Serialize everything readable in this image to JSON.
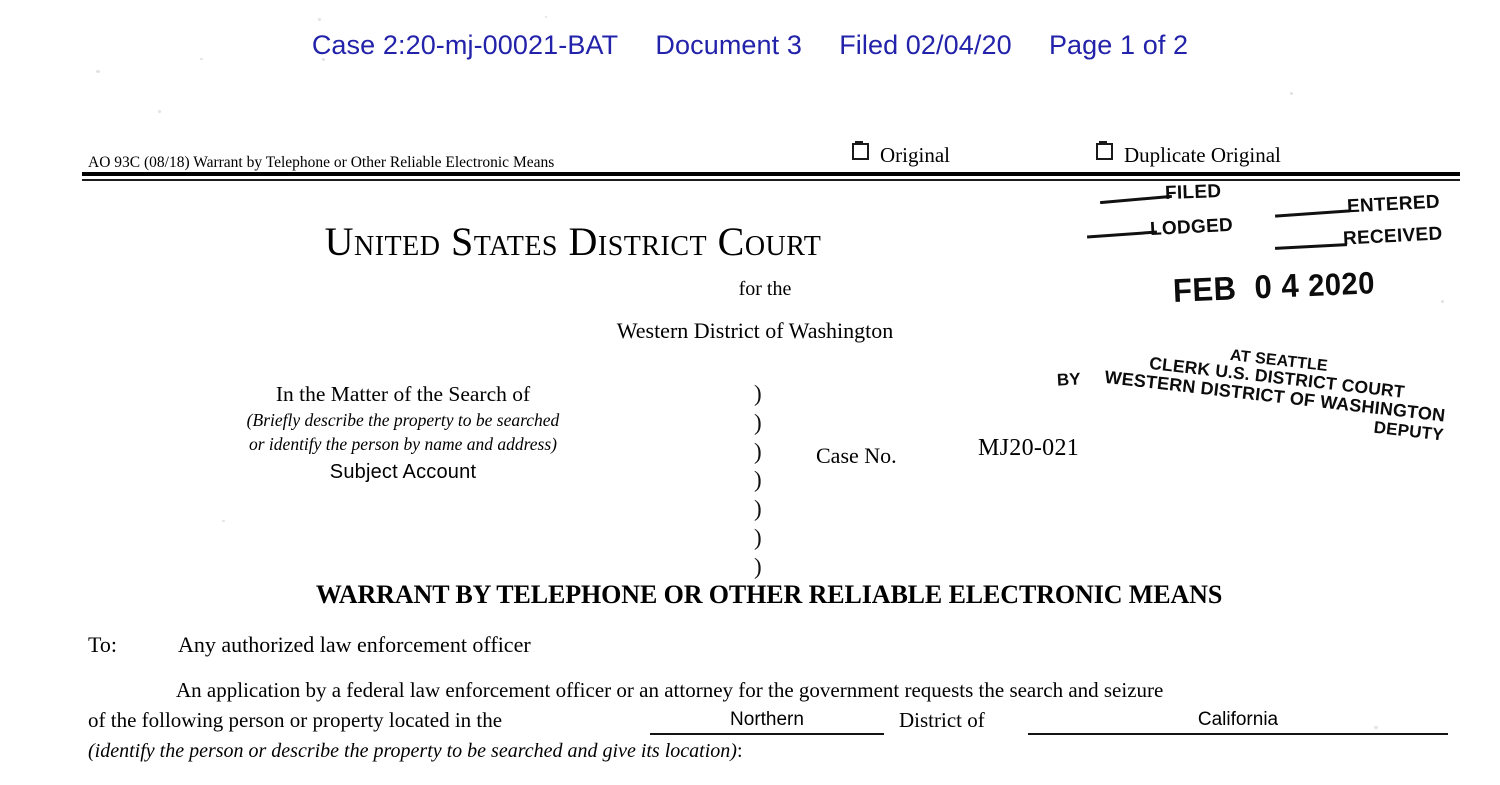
{
  "ecf_header": {
    "case": "Case 2:20-mj-00021-BAT",
    "document": "Document 3",
    "filed": "Filed 02/04/20",
    "page": "Page 1 of 2",
    "color": "#2222aa"
  },
  "form": {
    "ao_line": "AO 93C  (08/18)  Warrant by Telephone or Other Reliable Electronic Means",
    "checkbox_original": "Original",
    "checkbox_duplicate": "Duplicate Original"
  },
  "court": {
    "title": "United States District Court",
    "for_the": "for the",
    "district": "Western District of Washington"
  },
  "stamp": {
    "filed": "FILED",
    "lodged": "LODGED",
    "entered": "ENTERED",
    "received": "RECEIVED",
    "date_month": "FEB",
    "date_day": "0 4",
    "date_year": "2020",
    "by": "BY",
    "line1": "AT SEATTLE",
    "line2": "CLERK U.S. DISTRICT COURT",
    "line3": "WESTERN DISTRICT OF WASHINGTON",
    "line4": "DEPUTY"
  },
  "caption": {
    "title": "In the Matter of the Search of",
    "instruction_line1": "(Briefly describe the property to be searched",
    "instruction_line2": "or identify the person by name and address)",
    "subject": "Subject Account",
    "paren": ")",
    "paren_count": 7,
    "case_no_label": "Case No.",
    "case_no_value": "MJ20-021"
  },
  "warrant": {
    "title": "WARRANT BY TELEPHONE OR OTHER RELIABLE ELECTRONIC MEANS",
    "to_label": "To:",
    "to_value": "Any authorized law enforcement officer",
    "paragraph_line1": "An application by a federal law enforcement officer or an attorney for the government requests the search and seizure",
    "paragraph_line2": "of the following person or property located in the",
    "district_of_label": "District of",
    "fill_district": "Northern",
    "fill_state": "California",
    "instruction": "(identify the person or describe the property to be searched and give its location)",
    "instruction_tail": ":"
  }
}
